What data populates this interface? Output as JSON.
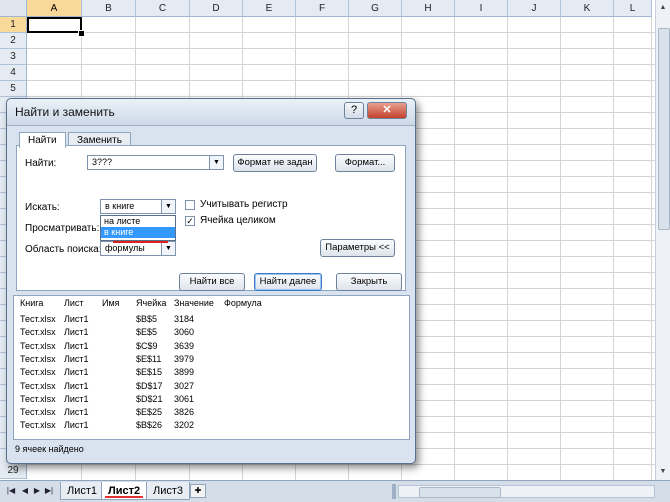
{
  "sheet": {
    "columns": [
      "A",
      "B",
      "C",
      "D",
      "E",
      "F",
      "G",
      "H",
      "I",
      "J",
      "K",
      "L"
    ],
    "rows": [
      "1",
      "2",
      "3",
      "4",
      "5"
    ],
    "last_row": "29",
    "tabs": [
      "Лист1",
      "Лист2",
      "Лист3"
    ],
    "active_tab": "Лист2"
  },
  "dialog": {
    "title": "Найти и заменить",
    "help": "?",
    "close": "✕",
    "tabs": [
      "Найти",
      "Заменить"
    ],
    "find_label": "Найти:",
    "find_value": "3???",
    "format_status": "Формат не задан",
    "format_button": "Формат...",
    "within_label": "Искать:",
    "within_value": "в книге",
    "within_options": [
      "на листе",
      "в книге"
    ],
    "search_label": "Просматривать:",
    "look_in_label": "Область поиска:",
    "look_in_value": "формулы",
    "match_case": "Учитывать регистр",
    "match_entire": "Ячейка целиком",
    "options_button": "Параметры <<",
    "find_all": "Найти все",
    "find_next": "Найти далее",
    "close_button": "Закрыть",
    "results_headers": [
      "Книга",
      "Лист",
      "Имя",
      "Ячейка",
      "Значение",
      "Формула"
    ],
    "results": [
      [
        "Тест.xlsx",
        "Лист1",
        "",
        "$B$5",
        "3184",
        ""
      ],
      [
        "Тест.xlsx",
        "Лист1",
        "",
        "$E$5",
        "3060",
        ""
      ],
      [
        "Тест.xlsx",
        "Лист1",
        "",
        "$C$9",
        "3639",
        ""
      ],
      [
        "Тест.xlsx",
        "Лист1",
        "",
        "$E$11",
        "3979",
        ""
      ],
      [
        "Тест.xlsx",
        "Лист1",
        "",
        "$E$15",
        "3899",
        ""
      ],
      [
        "Тест.xlsx",
        "Лист1",
        "",
        "$D$17",
        "3027",
        ""
      ],
      [
        "Тест.xlsx",
        "Лист1",
        "",
        "$D$21",
        "3061",
        ""
      ],
      [
        "Тест.xlsx",
        "Лист1",
        "",
        "$E$25",
        "3826",
        ""
      ],
      [
        "Тест.xlsx",
        "Лист1",
        "",
        "$B$26",
        "3202",
        ""
      ]
    ],
    "status": "9 ячеек найдено"
  }
}
